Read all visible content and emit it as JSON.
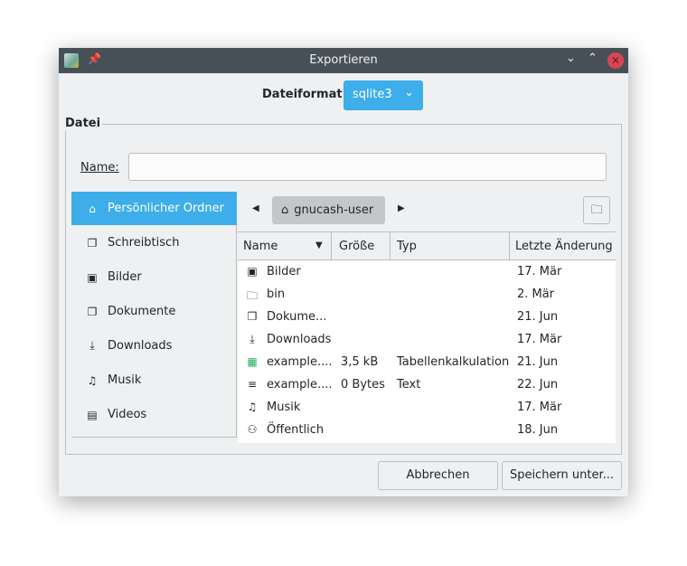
{
  "window": {
    "title": "Exportieren"
  },
  "format": {
    "label": "Dateiformat",
    "value": "sqlite3"
  },
  "group": {
    "legend": "Datei"
  },
  "name": {
    "label": "Name:",
    "value": ""
  },
  "sidebar": {
    "items": [
      {
        "label": "Persönlicher Ordner",
        "icon": "⌂",
        "selected": true
      },
      {
        "label": "Schreibtisch",
        "icon": "❐"
      },
      {
        "label": "Bilder",
        "icon": "▣"
      },
      {
        "label": "Dokumente",
        "icon": "❐"
      },
      {
        "label": "Downloads",
        "icon": "⤓"
      },
      {
        "label": "Musik",
        "icon": "♫"
      },
      {
        "label": "Videos",
        "icon": "▤"
      }
    ]
  },
  "path": {
    "current": "gnucash-user"
  },
  "table": {
    "headers": [
      "Name",
      "Größe",
      "Typ",
      "Letzte Änderung"
    ],
    "rows": [
      {
        "icon": "▣",
        "name": "Bilder",
        "size": "",
        "type": "",
        "date": "17. Mär"
      },
      {
        "icon": "🗀",
        "name": "bin",
        "size": "",
        "type": "",
        "date": "2. Mär"
      },
      {
        "icon": "❐",
        "name": "Dokume...",
        "size": "",
        "type": "",
        "date": "21. Jun"
      },
      {
        "icon": "⤓",
        "name": "Downloads",
        "size": "",
        "type": "",
        "date": "17. Mär"
      },
      {
        "icon": "▦",
        "name": "example....",
        "size": "3,5 kB",
        "type": "Tabellenkalkulation",
        "date": "21. Jun",
        "color": "#27ae60"
      },
      {
        "icon": "≡",
        "name": "example....",
        "size": "0 Bytes",
        "type": "Text",
        "date": "22. Jun"
      },
      {
        "icon": "♫",
        "name": "Musik",
        "size": "",
        "type": "",
        "date": "17. Mär"
      },
      {
        "icon": "⚇",
        "name": "Öffentlich",
        "size": "",
        "type": "",
        "date": "18. Jun"
      }
    ]
  },
  "buttons": {
    "cancel": "Abbrechen",
    "save": "Speichern unter..."
  }
}
